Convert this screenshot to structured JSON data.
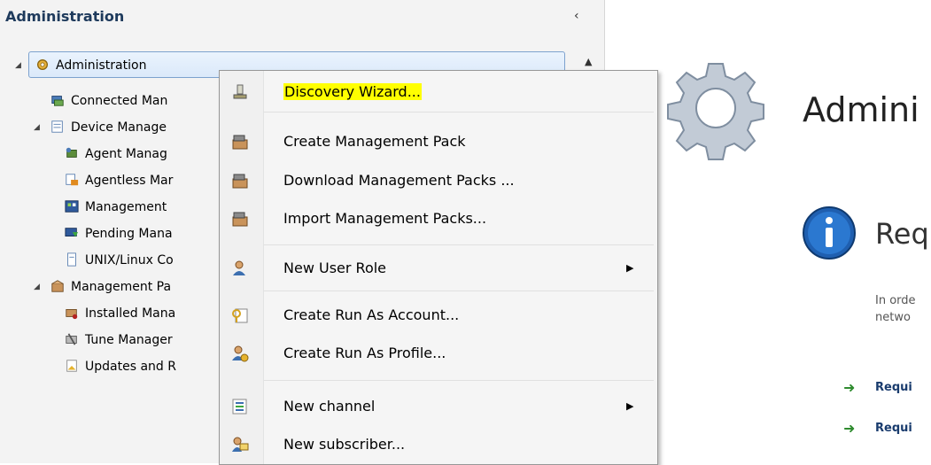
{
  "nav": {
    "title": "Administration",
    "collapse_glyph": "‹",
    "scroll_up_glyph": "▲",
    "tree": [
      {
        "label": "Administration",
        "icon": "gear-icon",
        "expanded": true,
        "selected": true
      },
      {
        "label": "Connected Man",
        "icon": "server-icon"
      },
      {
        "label": "Device Manage",
        "icon": "device-icon",
        "expanded": true
      },
      {
        "label": "Agent Manag",
        "icon": "agent-icon"
      },
      {
        "label": "Agentless Mar",
        "icon": "agentless-icon"
      },
      {
        "label": "Management ",
        "icon": "management-server-icon"
      },
      {
        "label": "Pending Mana",
        "icon": "pending-icon"
      },
      {
        "label": "UNIX/Linux Co",
        "icon": "unix-icon"
      },
      {
        "label": "Management Pa",
        "icon": "package-icon",
        "expanded": true
      },
      {
        "label": "Installed Mana",
        "icon": "installed-pack-icon"
      },
      {
        "label": "Tune Manager",
        "icon": "tune-icon"
      },
      {
        "label": "Updates and R",
        "icon": "updates-icon"
      }
    ]
  },
  "menu": {
    "items": [
      {
        "label": "Discovery Wizard...",
        "icon": "discovery-icon",
        "highlighted": true
      },
      {
        "label": "Create Management Pack",
        "icon": "pack-icon"
      },
      {
        "label": "Download Management Packs ...",
        "icon": "pack-icon"
      },
      {
        "label": "Import Management Packs...",
        "icon": "pack-icon"
      },
      {
        "label": "New User Role",
        "icon": "user-role-icon",
        "submenu": true
      },
      {
        "label": "Create Run As Account...",
        "icon": "key-icon"
      },
      {
        "label": "Create Run As Profile...",
        "icon": "profile-icon"
      },
      {
        "label": "New channel",
        "icon": "channel-icon",
        "submenu": true
      },
      {
        "label": "New subscriber...",
        "icon": "subscriber-icon"
      }
    ],
    "submenu_glyph": "▶",
    "highlight_color": "#ffff00"
  },
  "content": {
    "title": "Admini",
    "heading": "Req",
    "paragraph_lines": [
      "In orde",
      "netwo"
    ],
    "links": [
      "Requi",
      "Requi"
    ],
    "arrow_glyph": "➜"
  }
}
